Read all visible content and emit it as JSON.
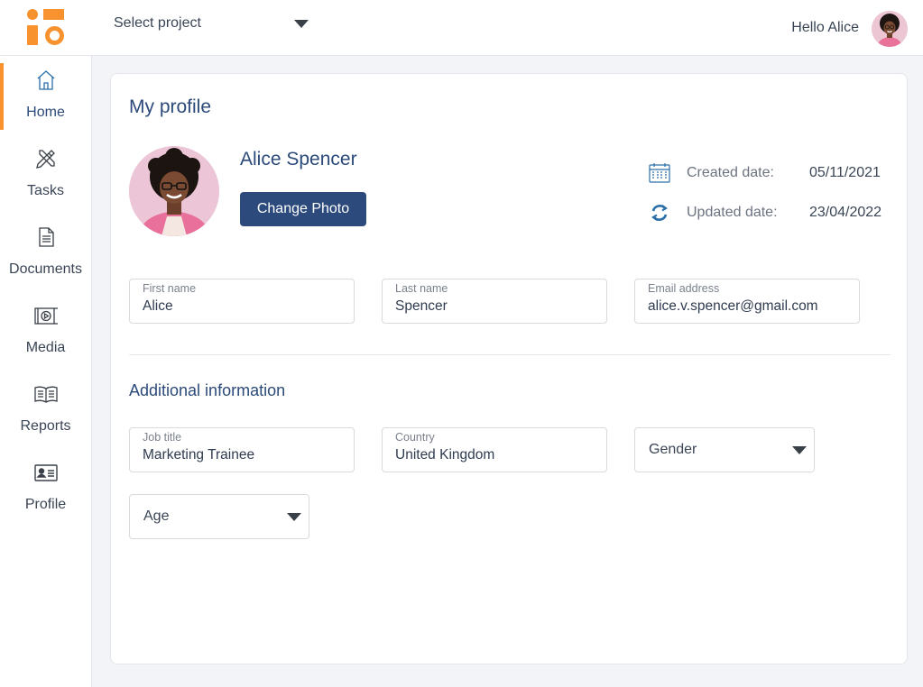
{
  "topbar": {
    "project_select": {
      "label": "Select project"
    },
    "greeting": "Hello Alice"
  },
  "sidebar": {
    "items": [
      {
        "label": "Home",
        "icon": "home-icon",
        "active": true
      },
      {
        "label": "Tasks",
        "icon": "tasks-icon",
        "active": false
      },
      {
        "label": "Documents",
        "icon": "document-icon",
        "active": false
      },
      {
        "label": "Media",
        "icon": "media-icon",
        "active": false
      },
      {
        "label": "Reports",
        "icon": "reports-icon",
        "active": false
      },
      {
        "label": "Profile",
        "icon": "profile-card-icon",
        "active": false
      }
    ]
  },
  "profile": {
    "title": "My profile",
    "name": "Alice Spencer",
    "change_photo_label": "Change Photo",
    "created": {
      "label": "Created date:",
      "value": "05/11/2021",
      "icon": "calendar-icon"
    },
    "updated": {
      "label": "Updated date:",
      "value": "23/04/2022",
      "icon": "refresh-icon"
    },
    "fields": {
      "first_name": {
        "label": "First name",
        "value": "Alice"
      },
      "last_name": {
        "label": "Last name",
        "value": "Spencer"
      },
      "email": {
        "label": "Email address",
        "value": "alice.v.spencer@gmail.com"
      }
    }
  },
  "additional": {
    "title": "Additional information",
    "job_title": {
      "label": "Job title",
      "value": "Marketing Trainee"
    },
    "country": {
      "label": "Country",
      "value": "United Kingdom"
    },
    "gender": {
      "value": "Gender"
    },
    "age": {
      "value": "Age"
    }
  },
  "colors": {
    "accent": "#f7922f",
    "primary": "#2c4a7c",
    "icon_blue": "#2c6ea8"
  }
}
